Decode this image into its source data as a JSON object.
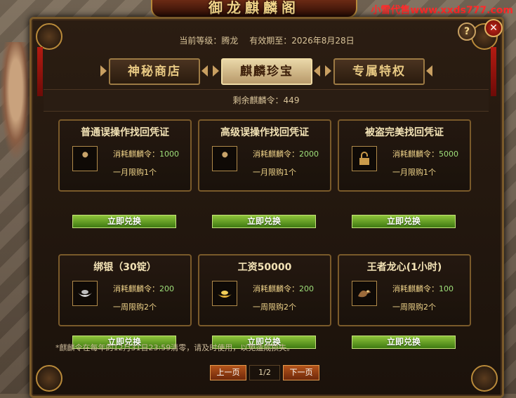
{
  "window_title": "御龙麒麟阁",
  "watermark": "小雪代售www.xxds777.com",
  "header": {
    "level_label": "当前等级：",
    "level_value": "腾龙",
    "expiry_label": "有效期至：",
    "expiry_value": "2026年8月28日",
    "help_label": "?",
    "close_label": "✕"
  },
  "tabs": [
    {
      "label": "神秘商店",
      "active": false
    },
    {
      "label": "麒麟珍宝",
      "active": true
    },
    {
      "label": "专属特权",
      "active": false
    }
  ],
  "remaining": {
    "label": "剩余麒麟令：",
    "value": "449"
  },
  "cost_label": "消耗麒麟令：",
  "redeem_label": "立即兑换",
  "items": [
    {
      "name": "普通误操作找回凭证",
      "icon": "wrench-icon",
      "cost": "1000",
      "limit": "一月限购1个"
    },
    {
      "name": "高级误操作找回凭证",
      "icon": "wrench-icon",
      "cost": "2000",
      "limit": "一月限购1个"
    },
    {
      "name": "被盗完美找回凭证",
      "icon": "lock-icon",
      "cost": "5000",
      "limit": "一月限购1个"
    },
    {
      "name": "绑银（30锭）",
      "icon": "silver-ingot-icon",
      "cost": "200",
      "limit": "一周限购2个"
    },
    {
      "name": "工资50000",
      "icon": "gold-ingot-icon",
      "cost": "200",
      "limit": "一周限购2个"
    },
    {
      "name": "王者龙心(1小时)",
      "icon": "dragon-icon",
      "cost": "100",
      "limit": "一周限购2个"
    }
  ],
  "note": "*麒麟令在每年的12月31日23:59清零，请及时使用，以免造成损失。",
  "pager": {
    "prev_label": "上一页",
    "page": "1/2",
    "next_label": "下一页"
  },
  "colors": {
    "accent_gold": "#f0d48a",
    "cost_green": "#9fe07a",
    "button_green": "#6aa82a",
    "watermark_red": "#ff2a2a"
  }
}
